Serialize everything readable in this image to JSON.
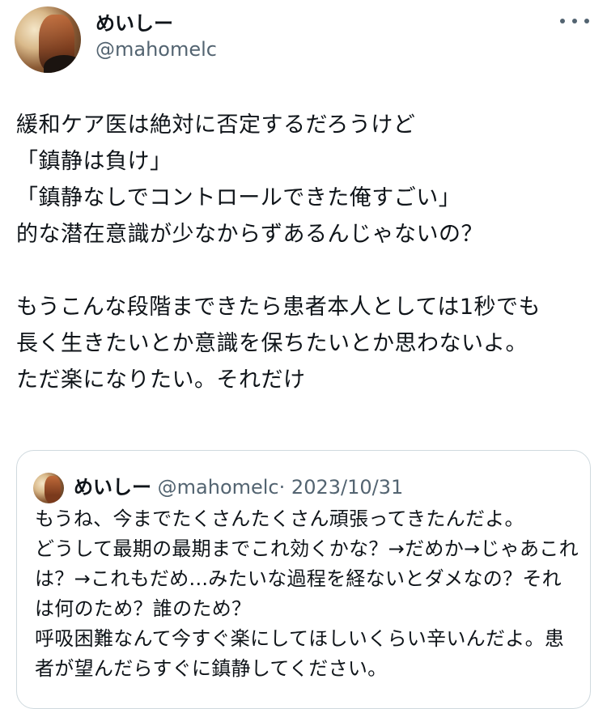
{
  "author": {
    "display_name": "めいしー",
    "handle": "@mahomelc",
    "avatar_icon": "profile-photo"
  },
  "more_icon": "more-horizontal-icon",
  "tweet": {
    "text": "緩和ケア医は絶対に否定するだろうけど\n「鎮静は負け」\n「鎮静なしでコントロールできた俺すごい」\n的な潜在意識が少なからずあるんじゃないの？\n\nもうこんな段階まできたら患者本人としては1秒でも\n長く生きたいとか意識を保ちたいとか思わないよ。\nただ楽になりたい。それだけ"
  },
  "quote": {
    "display_name": "めいしー",
    "handle": "@mahomelc",
    "separator": "·",
    "date": "2023/10/31",
    "text": "もうね、今までたくさんたくさん頑張ってきたんだよ。\nどうして最期の最期までこれ効くかな？→だめか→じゃあこれは？→これもだめ...みたいな過程を経ないとダメなの？それは何のため？誰のため？\n呼吸困難なんて今すぐ楽にしてほしいくらい辛いんだよ。患者が望んだらすぐに鎮静してください。"
  },
  "colors": {
    "text_primary": "#0f1419",
    "text_secondary": "#536471",
    "border": "#cfd9de",
    "background": "#ffffff"
  }
}
